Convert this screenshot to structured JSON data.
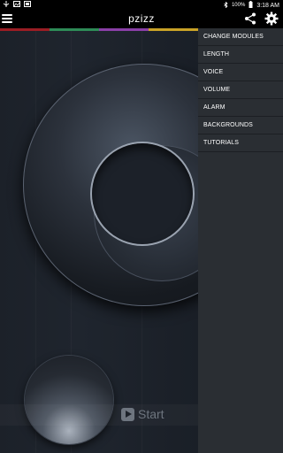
{
  "status_bar": {
    "battery": "100%",
    "time": "3:18 AM"
  },
  "action_bar": {
    "title": "pzizz"
  },
  "color_bar": {
    "colors": [
      "#9b1d24",
      "#2e8b57",
      "#8a3fa7",
      "#c9a227"
    ]
  },
  "start": {
    "label": "Start"
  },
  "side_menu": {
    "items": [
      {
        "label": "CHANGE MODULES"
      },
      {
        "label": "LENGTH"
      },
      {
        "label": "VOICE"
      },
      {
        "label": "VOLUME"
      },
      {
        "label": "ALARM"
      },
      {
        "label": "BACKGROUNDS"
      },
      {
        "label": "TUTORIALS"
      }
    ]
  },
  "icons": {
    "menu": "hamburger-menu-icon",
    "share": "share-icon",
    "settings": "gear-icon",
    "play": "play-icon"
  }
}
